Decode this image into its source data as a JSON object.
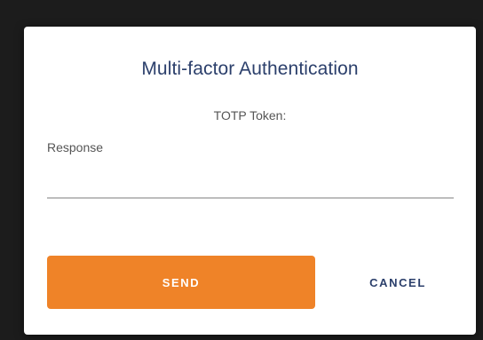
{
  "dialog": {
    "title": "Multi-factor Authentication",
    "subtitle": "TOTP Token:",
    "field": {
      "label": "Response",
      "value": ""
    },
    "actions": {
      "send_label": "SEND",
      "cancel_label": "CANCEL"
    }
  },
  "colors": {
    "backdrop": "#1c1c1c",
    "title": "#2b3f6b",
    "primary_button": "#ef8328",
    "cancel_text": "#2b3f6b",
    "input_underline": "#bdbdbd"
  }
}
